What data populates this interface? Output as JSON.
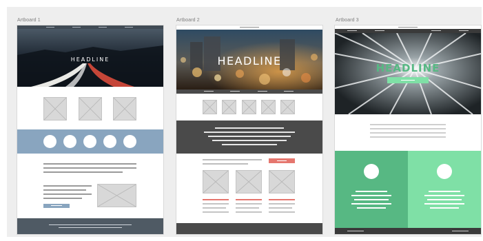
{
  "workspace": {
    "artboards": [
      {
        "label": "Artboard 1",
        "headline": "HEADLINE"
      },
      {
        "label": "Artboard 2",
        "headline": "HEADLINE"
      },
      {
        "label": "Artboard 3",
        "headline": "HEADLINE"
      }
    ]
  },
  "colors": {
    "pasteboard": "#eeeeee",
    "nav_dark": "#414b55",
    "band_blue": "#89a5bf",
    "band_gray": "#4a4a4a",
    "green_dark": "#57b883",
    "green_light": "#7fe0a6",
    "accent_red": "#e5766e",
    "placeholder": "#d8d8d8"
  },
  "icons": [
    "image-placeholder-icon",
    "circle-avatar-icon"
  ]
}
